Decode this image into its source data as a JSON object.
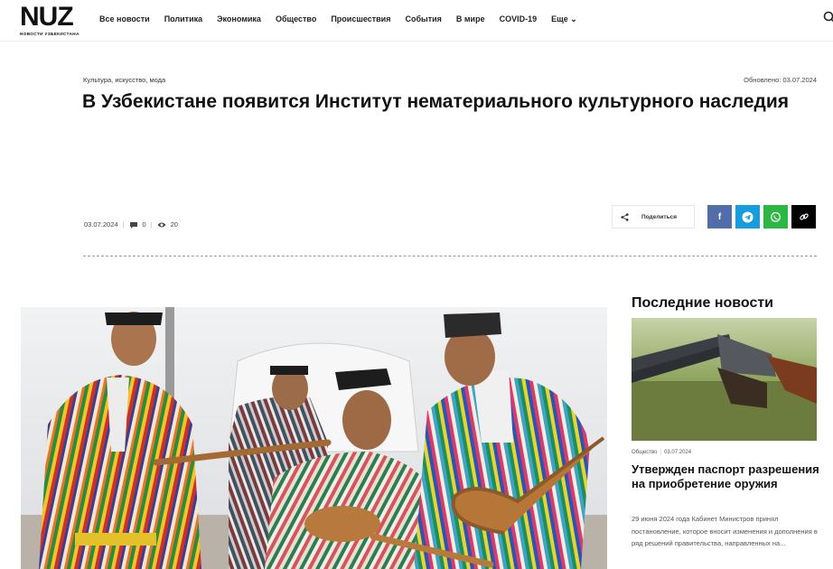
{
  "header": {
    "logo": {
      "main": "NUZ",
      "sub": "НОВОСТИ УЗБЕКИСТАНА"
    },
    "nav": [
      "Все новости",
      "Политика",
      "Экономика",
      "Общество",
      "Происшествия",
      "События",
      "В мире",
      "COVID-19",
      "Еще ⌄"
    ]
  },
  "article": {
    "category": "Культура, искусство, мода",
    "updated": "Обновлено: 03.07.2024",
    "title": "В Узбекистане появится Институт нематериального культурного наследия",
    "date": "03.07.2024",
    "comments": "0",
    "views": "20"
  },
  "share": {
    "label": "Поделиться"
  },
  "social": {
    "facebook": "f"
  },
  "sidebar": {
    "heading": "Последние новости",
    "item": {
      "category": "Общество",
      "date": "03.07.2024",
      "title": "Утвержден паспорт разрешения на приобретение оружия",
      "excerpt": "29 июня 2024 года Кабинет Министров принял постановление, которое вносит изменения и дополнения в ряд решений правительства, направленных на..."
    }
  },
  "colors": {
    "facebook": "#516eab",
    "telegram": "#179cde",
    "whatsapp": "#2cb742",
    "copy": "#000000"
  }
}
